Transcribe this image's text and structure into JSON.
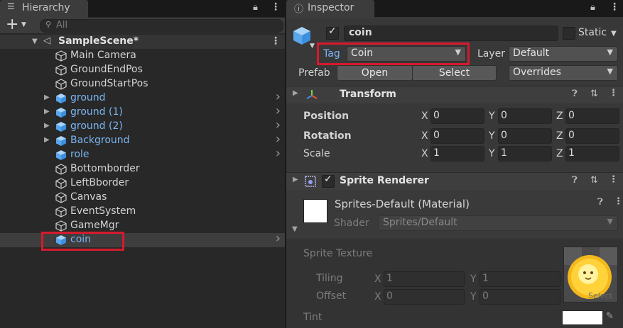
{
  "hierarchy": {
    "tab_title": "Hierarchy",
    "search_placeholder": "All",
    "add_label": "+",
    "scene_name": "SampleScene*",
    "items": [
      {
        "label": "Main Camera",
        "prefab": false
      },
      {
        "label": "GroundEndPos",
        "prefab": false
      },
      {
        "label": "GroundStartPos",
        "prefab": false
      },
      {
        "label": "ground",
        "prefab": true
      },
      {
        "label": "ground (1)",
        "prefab": true
      },
      {
        "label": "ground (2)",
        "prefab": true
      },
      {
        "label": "Background",
        "prefab": true
      },
      {
        "label": "role",
        "prefab": true
      },
      {
        "label": "Bottomborder",
        "prefab": false
      },
      {
        "label": "LeftBborder",
        "prefab": false
      },
      {
        "label": "Canvas",
        "prefab": false
      },
      {
        "label": "EventSystem",
        "prefab": false
      },
      {
        "label": "GameMgr",
        "prefab": false
      },
      {
        "label": "coin",
        "prefab": true,
        "selected": true
      }
    ]
  },
  "inspector": {
    "tab_title": "Inspector",
    "object_name": "coin",
    "static_label": "Static",
    "tag_label": "Tag",
    "tag_value": "Coin",
    "layer_label": "Layer",
    "layer_value": "Default",
    "prefab_label": "Prefab",
    "open_label": "Open",
    "select_label": "Select",
    "overrides_label": "Overrides",
    "transform": {
      "title": "Transform",
      "position_label": "Position",
      "rotation_label": "Rotation",
      "scale_label": "Scale",
      "position": [
        "0",
        "0",
        "0"
      ],
      "rotation": [
        "0",
        "0",
        "0"
      ],
      "scale": [
        "1",
        "1",
        "1"
      ],
      "x": "X",
      "y": "Y",
      "z": "Z"
    },
    "sprite_renderer": {
      "title": "Sprite Renderer",
      "material_title": "Sprites-Default (Material)",
      "shader_label": "Shader",
      "shader_value": "Sprites/Default",
      "sprite_texture_label": "Sprite Texture",
      "tiling_label": "Tiling",
      "offset_label": "Offset",
      "tiling": [
        "1",
        "1"
      ],
      "offset": [
        "0",
        "0"
      ],
      "tint_label": "Tint",
      "select_overlay": "Select",
      "x": "X",
      "y": "Y"
    }
  },
  "colors": {
    "prefab_blue": "#7bb6f3",
    "highlight_red": "#d8192d",
    "selected_row": "#3e3e3e"
  }
}
